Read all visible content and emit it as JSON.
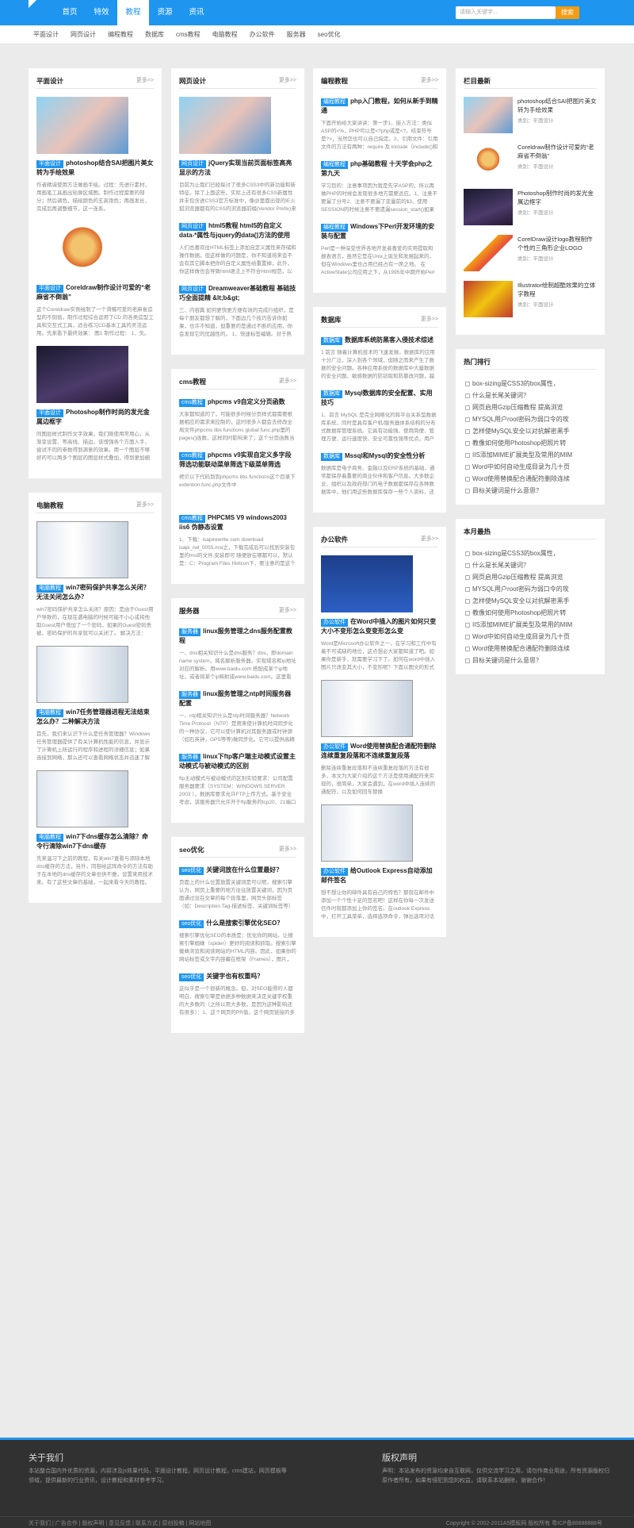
{
  "nav": {
    "items": [
      "首页",
      "特效",
      "教程",
      "资源",
      "资讯"
    ],
    "active": 2,
    "search_placeholder": "请输入关键字...",
    "search_btn": "搜索"
  },
  "subnav": [
    "平面设计",
    "网页设计",
    "编程教程",
    "数据库",
    "cms教程",
    "电脑教程",
    "办公软件",
    "服务器",
    "seo优化"
  ],
  "more": "更多>>",
  "col1": [
    {
      "title": "平面设计",
      "items": [
        {
          "tag": "平面设计",
          "title": "photoshop结合SAI把图片美女转为手绘效果",
          "desc": "作者精诚使用方法做画手绘。过程：先进行素材，用画笔工具画出轮廓区域图。制作过程需要的部分；然后调色，描绘颜色的五高饱色；再画发丝，完成后再调整细节，这一连系。"
        },
        {
          "tag": "平面设计",
          "title": "Coreldraw制作设计可爱的“老麻省不倒翁”",
          "desc": "这个Coreldraw实例绘制了一个滑稽可爱的老麻省造型的不倒翁，制作过程综合运用了CD 的各类造型工具和交互式工具，适合练习CD基本工具的灵活运用。先来看下最终效果：  图1  制作过程：  1、矢。"
        },
        {
          "tag": "平面设计",
          "title": "Photoshop制作时尚的发光金属边框字",
          "desc": "同图层样式制作文字效果，我们刚使用常用心，从渐变设置、等高线、描边，该增强各个方面入手，尝试不同的参数得到满意的效果。用一个图层不够好的可以两多个图层的图层样式叠加，得到更加细腻的效果。最终效果"
        }
      ]
    },
    {
      "title": "电脑教程",
      "items": [
        {
          "tag": "电脑教程",
          "title": "win7密码保护共享怎么关闭？无法关闭怎么办？",
          "desc": "win7密码保护共享怎么关闭？原因：是由于Guest用户导致的，在现在遇电脑的时候可能不小心或将他取Guest用户增加了一个密码，如果的Guest密码丢被，密码保护的共享就可以关闭了。  解决方法：  1、首先，右击计"
        },
        {
          "tag": "电脑教程",
          "title": "win7任务管理器进程无法结束怎么办？二种解决方法",
          "desc": "首先，我们来认识下什么是任务管理器？Windows任务管理器提供了有关计算机性能的信息，并显示了计算机上所运行的程序和进程的详细信息；如果连接到网络，那么还可以查看网络状态并迅速了解网络是如何工作的。有"
        },
        {
          "tag": "电脑教程",
          "title": "win7下dns缓存怎么清除？命令行清除win7下dns缓存",
          "desc": "先来温习下之前的教程，有关win7查看与添除本地dns缓存的方法，另外，同容给这阵命令的方法有助于在本地的dns缓存的文章也供不雅，设置来用技术来。有了这些文章的基础，一起来看今天的教程。操作步骤：1、首先，运行"
        }
      ]
    }
  ],
  "col2": [
    {
      "title": "网页设计",
      "items": [
        {
          "tag": "网页设计",
          "title": "jQuery实现当前页面标签高亮显示的方法",
          "desc": "目前为止我们已经探讨了很多CSS3中的新功能和新特征。除了上面这些，实际上还有很多CSS新属性并未包含进CSS3官方标准中，像@里面出现的IE火狐浏览器都有的CSS的浏览器前缀(Vendor Prefix)来实现很多效果"
        },
        {
          "tag": "网页设计",
          "title": "html5教程 html5的自定义data-*属性与jquery的data()方法的使用",
          "desc": "人们总喜欢往HTML标签上添加自定义属性来存储和操作数据。但这样做的问题是，你不知道将来会不会有其它脚本把你的自定义属性给重置掉，此外，你这样做也会导致html语法上不符合Html规范，以及一些其它副作用。这"
        },
        {
          "tag": "网页设计",
          "title": "Dreamweaver基础教程 基础技巧全面提精 &lt;b&gt;",
          "desc": "三、内容篇  如何更快更方便有效的完成行组织，是每个朋友都想了解的，下面边几个技巧告诉你如果，也许不知道，但重要的是通过不断的应用，你会发现它的优越性的。  1、快速标签编辑。对于熟悉手写代码的朋"
        }
      ]
    },
    {
      "title": "cms教程",
      "items": [
        {
          "tag": "cms教程",
          "title": "phpcms v9自定义分页函数",
          "desc": "大家都知道的了，可能很多时候分页样式都需要根据相应的需求来控制的，这时很多人都会去修改全局文件phpcms libs functions global func.php里的pages()函数，这样同时影响来了；这个分页函数当前，包含参数来"
        },
        {
          "tag": "cms教程",
          "title": "phpcms v9实现自定义多字段筛选功能联动菜单筛选下级菜单筛选",
          "desc": "拷贝以下代码到到phpcms libs functions这个目录下extention.func.php文件中"
        },
        {
          "tag": "cms教程",
          "title": "PHPCMS V9 windows2003 iis6 伪静态设置",
          "desc": "1、下载：isapirewrite com download isapi_rwl_0055.msi之，下载完成后可以找到安装包里的msi的文件,安装即可 随便放在哪都可以，默认是：C：Program Files Helicon下，要注意的是这个目录everyone要有读取"
        }
      ]
    },
    {
      "title": "服务器",
      "items": [
        {
          "tag": "服务器",
          "title": "linux服务管理之dns服务配置教程",
          "desc": "一、dns相关知识什么是dns服务？dns，即domain name system，域名解析服务器。实现域名和ip地址对应的解析。用www.baidu.com 搭配成某个ip地址，或者将某个ip映射成www.baidu.com。这里看个小站同，没有域名"
        },
        {
          "tag": "服务器",
          "title": "linux服务管理之ntp时间服务器配置",
          "desc": "一、ntp相关知识什么是ntp时间服务器？Network Time Protocol（NTP）是用来使计算机时间同步化的一种协议，它可以使计算机对其服务器或时钟源（如石英钟，GPS等等)做同步化，它可以提供高精准度的时间校正（L"
        },
        {
          "tag": "服务器",
          "title": "linux下ftp客户端主动模式设置主动模式与被动模式的区别",
          "desc": "ftp主动模式与被动模式的区别实验要求：公司配置服务器要求（SYSTEM：WINDOWS SERVER 2003 ），数据库要求允许FTP上传方式。基于安全考虑，该服务器只允许开于ftp服务的tcp20、21端口数据流通过，FTP模式选"
        }
      ]
    },
    {
      "title": "seo优化",
      "items": [
        {
          "tag": "seo优化",
          "title": "关键词放在什么位置最好？",
          "desc": "页面上的什么位置放置关键词是可以呢，搜索引擎认为，网页上重要的地方往往放置关键词，因为页面通过设在文章的每个段落里，网页头部标签（如：Description Tag-描述标签、关键词标签等）应该放着关键词；网页上面的"
        },
        {
          "tag": "seo优化",
          "title": "什么是搜索引擎优化SEO？",
          "desc": "搜索引擎优化SEO的本质是：优化你的网站，让搜索引擎蜘蛛（spider）更好的阅读和抓取。搜索引擎蜘蛛浏览和阅读网站的HTML内容。因此，如果你的网站标签或文字内容藏在框架（Frames），图片，JavaScript或Flash，则"
        },
        {
          "tag": "seo优化",
          "title": "关键字也有权重吗？",
          "desc": "这似乎是一个很新的概念。但，对SEO能得的人都明白，搜索引擎是依据多种数据来决定关键字权重的大多数的（之所以用大多数，是因为这种影响还有很多）：1、这个网页的PR值，这个网页链接的多少值；2、关键字在网页的"
        }
      ]
    }
  ],
  "col3": [
    {
      "title": "编程教程",
      "items": [
        {
          "tag": "编程教程",
          "title": "php入门教程，如何从新手到精通",
          "desc": "下面开始给大家讲讲：第一步1、嵌入方法：类似ASP的<%，PHP可以是<?php或是<?，结束符号是?>，当然您也可以自己指定。2、引用文件：引用文件的方法有两种：require 及 include（include()和require()的区别）"
        },
        {
          "tag": "编程教程",
          "title": "php基础教程 十天学会php之第九天",
          "desc": "学习目的：注意事项因为我是先学ASP的，所以再做PHP的时候会发现很多地方需要适应。1、注意不要漏了分号2、注意不要漏了变量前的$3、使用SESSION的时候注意不要遗漏session_start()如果发生错误的时候，可以采用"
        },
        {
          "tag": "编程教程",
          "title": "Windows下Perl开发环境的安装与配置",
          "desc": "Perl是一种深受世界各地开发者喜爱的实用提取和报表语言，虽然它是在Unix上诞生和发展起来的，但在Windows里也占用已经占有一席之地。  在ActiveState公司应用之下，从1995年中期开始Perl开始了独立地发展"
        }
      ]
    },
    {
      "title": "数据库",
      "items": [
        {
          "tag": "数据库",
          "title": "数据库系统防黑客入侵技术综述",
          "desc": "1  前言  随着计算机技术的飞速发展，数据库的应用十分广泛，深入到各个领域，但随之而来产生了数据的安全问题。各种应用系统的数据库中大量数据的安全问题、敏感数据的防窃取和防篡改问题，越来越引起人"
        },
        {
          "tag": "数据库",
          "title": "Mysql数据库的安全配置、实用技巧",
          "desc": "1、前言  MySQL 是完全网络化的跨平台关系型数据库系统，同时是具有客户机/服务器体系结构的分布式数据库管理系统。它具有功能强、使用简便、管理方便、运行速度快、安全可靠性强等优点，用户可利用许多语"
        },
        {
          "tag": "数据库",
          "title": "Mssql和Mysql的安全性分析",
          "desc": "数据库是电子商务、金融以及ERP系统的基础，通常都保存着重要的商业伙伴和客户信息。大多数企业、组织以及政府部门的电子数据都保存在各种数据库中，他们用这些数据库保存一些个人资料，还掌握着敏感的金融数据"
        }
      ]
    },
    {
      "title": "办公软件",
      "items": [
        {
          "tag": "办公软件",
          "title": "在Word中插入的图片如何只变大小不变形怎么变变形怎么变",
          "desc": "Word是Microsoft办公软件之一，在学习和工作中有着不可或缺的地位，这点想必大家都知道了吧。如果你是新手，就需要学习下了。如何在word中插入图片只改变其大小，不变形呢？下面以图文的形式为大家展现下，首先"
        },
        {
          "tag": "办公软件",
          "title": "Word使用替换配合通配符删除连续重复段落和不连续重复段落",
          "desc": "删除连续重复段落和不连续重复段落的方法有很多，本文为大家介绍的这个方法是使用通配符来实现的，很简单，大家会遇到，在word中插入连续的通配符，以及如何回车替换"
        },
        {
          "tag": "办公软件",
          "title": "给Outlook Express自动添加邮件签名",
          "desc": "想不想让你的邮件具有自己的特色？那就在邮件中添加一个个性十足的签名吧！这样在你每一次发送信件时就都添加上你的签名。在outlook Express中，打开工具菜单，选择选项命令，弹出选项对话框，单击签"
        }
      ]
    }
  ],
  "col4": {
    "latest": {
      "title": "栏目最新",
      "items": [
        {
          "title": "photoshop结合SAI把图片美女转为手绘效果",
          "cat": "类别：平面设计"
        },
        {
          "title": "Coreldraw制作设计可爱的“老麻省不倒翁”",
          "cat": "类别：平面设计"
        },
        {
          "title": "Photoshop制作时尚的发光金属边框字",
          "cat": "类别：平面设计"
        },
        {
          "title": "CorelDraw设计logo教程制作个性的三角形企业LOGO",
          "cat": "类别：平面设计"
        },
        {
          "title": "Illustrator绘制超酷效果的立体字教程",
          "cat": "类别：平面设计"
        }
      ]
    },
    "hot": {
      "title": "热门排行",
      "items": [
        "box-sizing是CSS3的box属性，",
        "什么是长尾关键词？",
        "网页启用Gzip压缩教程 提高浏览",
        "MYSQL用户root密码为弱口令的攻",
        "怎样使MySQL安全以对抗解密黑手",
        "教像如何使用Photoshop把照片转",
        "IIS添加MIME扩展类型及常用的MIM",
        "Word中如何自动生成目录为几十页",
        "Word使用替换配合通配符删除连续",
        "目标关键词是什么意思？"
      ]
    },
    "month": {
      "title": "本月最热",
      "items": [
        "box-sizing是CSS3的box属性，",
        "什么是长尾关键词？",
        "网页启用Gzip压缩教程 提高浏览",
        "MYSQL用户root密码为弱口令的攻",
        "怎样使MySQL安全以对抗解密黑手",
        "教像如何使用Photoshop把照片转",
        "IIS添加MIME扩展类型及常用的MIM",
        "Word中如何自动生成目录为几十页",
        "Word使用替换配合通配符删除连续",
        "目标关键词是什么意思？"
      ]
    }
  },
  "footer": {
    "about_title": "关于我们",
    "about_text": "本站整合国内外优质的资源，内容涉及js效果代码，平面设计教程，网页设计教程，cms建站，网页模板等领域，提供最新的行业资讯，设计教程和素材参考学习。",
    "copy_title": "版权声明",
    "copy_text": "声明：本站发布的资源均来自互联网，仅供交流学习之用，请勿作商业用途，所有资源版权归原作者所有，如果有侵犯到您的权益，请联系本站删除，谢谢合作！",
    "links": "关于我们 | 广告合作 | 版权声明 | 意见反馈 | 联系方式 | 原创投稿 | 网站地图",
    "copyright": "Copyright © 2002-2011A5模板网 版权所有  粤ICP备88888888号"
  }
}
